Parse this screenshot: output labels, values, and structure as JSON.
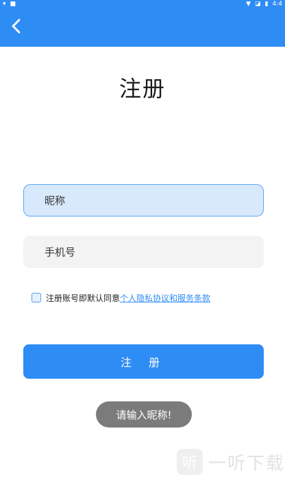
{
  "statusbar": {
    "time": "4:4"
  },
  "header": {
    "back_icon": "chevron-left-icon",
    "color": "#2e8cf5"
  },
  "page": {
    "title": "注册"
  },
  "form": {
    "nickname_placeholder": "昵称",
    "phone_placeholder": "手机号",
    "agreement_prefix": "注册账号即默认同意",
    "agreement_link": "个人隐私协议和服务条款",
    "register_label": "注 册"
  },
  "toast": {
    "message": "请输入昵称!"
  },
  "watermark": {
    "text": "一听下载",
    "logo_glyph": "听"
  }
}
